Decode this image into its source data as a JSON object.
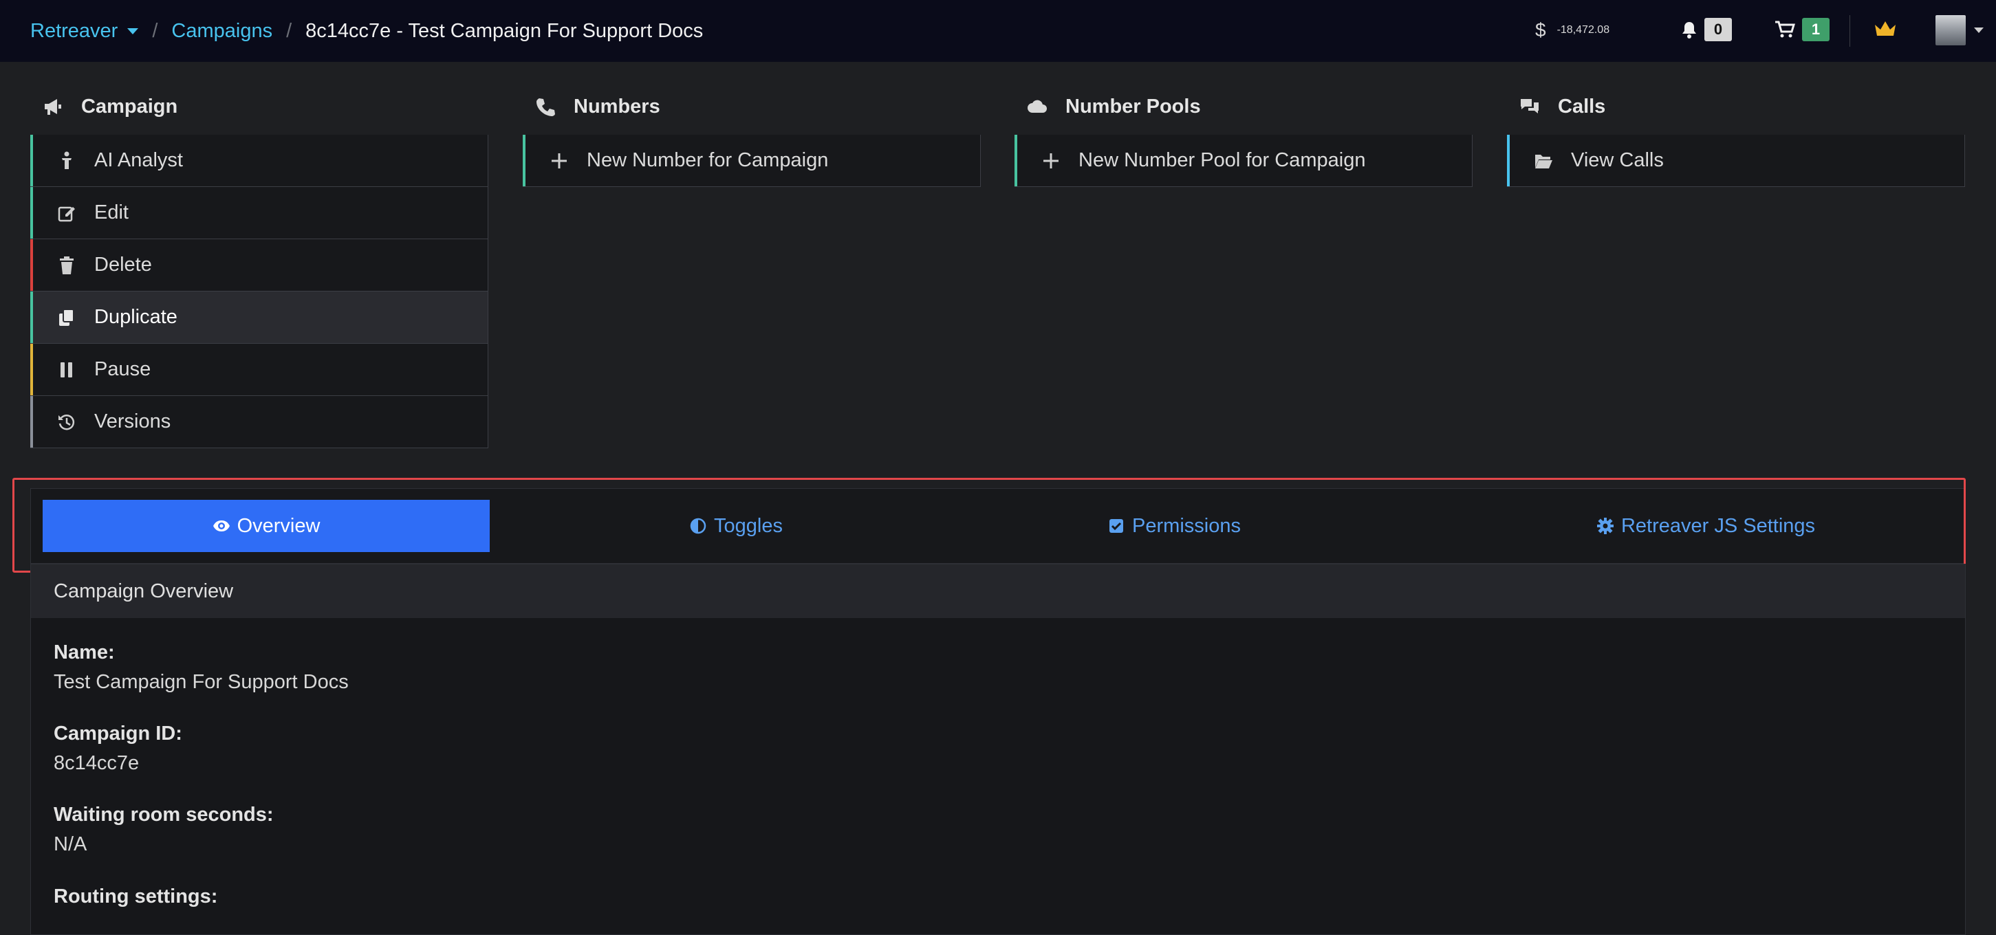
{
  "navbar": {
    "brand": "Retreaver",
    "crumb_campaigns": "Campaigns",
    "crumb_current": "8c14cc7e - Test Campaign For Support Docs",
    "balance": "-18,472.08",
    "balance_symbol": "$",
    "notifications_count": "0",
    "cart_count": "1"
  },
  "columns": {
    "campaign": {
      "title": "Campaign",
      "items": [
        {
          "label": "AI Analyst",
          "accent": "#48c3a0"
        },
        {
          "label": "Edit",
          "accent": "#48c3a0"
        },
        {
          "label": "Delete",
          "accent": "#d9413d"
        },
        {
          "label": "Duplicate",
          "accent": "#48c3a0"
        },
        {
          "label": "Pause",
          "accent": "#e0b43a"
        },
        {
          "label": "Versions",
          "accent": "#8a8f99"
        }
      ]
    },
    "numbers": {
      "title": "Numbers",
      "items": [
        {
          "label": "New Number for Campaign"
        }
      ]
    },
    "pools": {
      "title": "Number Pools",
      "items": [
        {
          "label": "New Number Pool for Campaign"
        }
      ]
    },
    "calls": {
      "title": "Calls",
      "items": [
        {
          "label": "View Calls"
        }
      ]
    }
  },
  "tabs": [
    {
      "label": "Overview",
      "icon": "eye-icon",
      "active": true
    },
    {
      "label": "Toggles",
      "icon": "half-circle-icon",
      "active": false
    },
    {
      "label": "Permissions",
      "icon": "checkbox-icon",
      "active": false
    },
    {
      "label": "Retreaver JS Settings",
      "icon": "gear-icon",
      "active": false
    }
  ],
  "overview": {
    "heading": "Campaign Overview",
    "fields": [
      {
        "label": "Name:",
        "value": "Test Campaign For Support Docs"
      },
      {
        "label": "Campaign ID:",
        "value": "8c14cc7e"
      },
      {
        "label": "Waiting room seconds:",
        "value": "N/A"
      },
      {
        "label": "Routing settings:",
        "value": ""
      }
    ]
  },
  "colors": {
    "tab_active": "#2f6df6",
    "tab_text": "#5aa0f0",
    "link": "#48c3ee",
    "highlight_outline": "#e2474a",
    "cart_badge": "#3f9f6a",
    "notification_badge": "#d6d6d6"
  }
}
